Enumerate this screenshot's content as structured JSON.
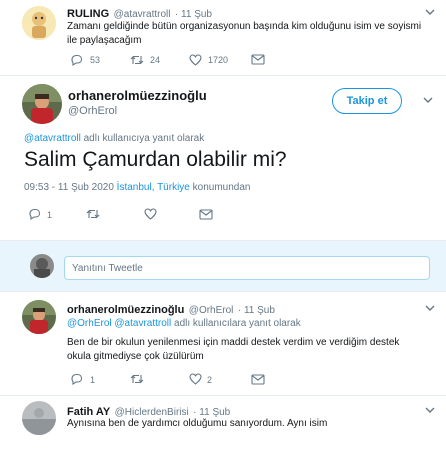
{
  "prev_tweet": {
    "name": "RULING",
    "handle": "@atavrattroll",
    "date": "· 11 Şub",
    "text_line1": "Zamanı geldiğinde bütün organizasyonun başında kim olduğunu isim ve soyismi",
    "text_line2": "ile paylaşacağım",
    "reply_count": "53",
    "retweet_count": "24",
    "like_count": "1720"
  },
  "main_tweet": {
    "name": "orhanerolmüezzinoğlu",
    "handle": "@OrhErol",
    "follow_label": "Takip et",
    "reply_context_user": "@atavrattroll",
    "reply_context_suffix": " adlı kullanıcıya yanıt olarak",
    "text": "Salim Çamurdan olabilir mi?",
    "time": "09:53 - 11 Şub 2020 ",
    "location": "İstanbul, Türkiye",
    "location_suffix": " konumundan",
    "reply_count": "1"
  },
  "composer": {
    "placeholder": "Yanıtını Tweetle"
  },
  "reply1": {
    "name": "orhanerolmüezzinoğlu",
    "handle": "@OrhErol",
    "date": "· 11 Şub",
    "context_user1": "@OrhErol",
    "context_user2": "@atavrattroll",
    "context_suffix": " adlı kullanıcılara yanıt olarak",
    "text_line1": "Ben de bir okulun yenilenmesi için maddi destek verdim ve verdiğim destek",
    "text_line2": "okula gitmediyse çok üzülürüm",
    "reply_count": "1",
    "like_count": "2"
  },
  "reply2": {
    "name": "Fatih AY",
    "handle": "@HiclerdenBirisi",
    "date": "· 11 Şub",
    "text": "Aynısına ben de yardımcı olduğumu sanıyordum. Aynı isim"
  },
  "colors": {
    "accent": "#1b95e0",
    "muted": "#657786",
    "like": "#e0245e"
  }
}
